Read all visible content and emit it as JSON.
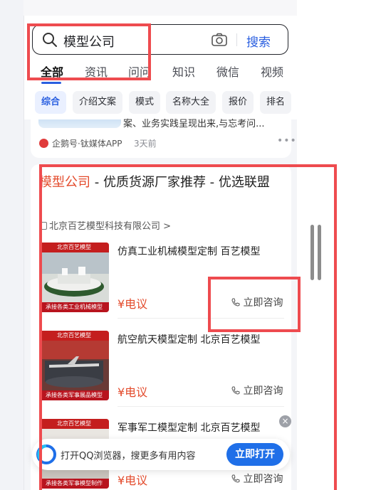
{
  "search": {
    "query": "模型公司",
    "button_label": "搜索"
  },
  "tabs": [
    {
      "label": "全部"
    },
    {
      "label": "资讯"
    },
    {
      "label": "问问"
    },
    {
      "label": "知识"
    },
    {
      "label": "微信"
    },
    {
      "label": "视频"
    }
  ],
  "chips": [
    {
      "label": "综合"
    },
    {
      "label": "介绍文案"
    },
    {
      "label": "模式"
    },
    {
      "label": "名称大全"
    },
    {
      "label": "报价"
    },
    {
      "label": "排名"
    }
  ],
  "prev_card": {
    "snippet": "案、业务实践呈现出来,与忘考问...",
    "source": "企鹅号·钛媒体APP",
    "time": "3天前"
  },
  "ad": {
    "title_highlight": "模型公司",
    "title_rest": " - 优质货源厂家推荐 - 优选联盟",
    "company": "北京百艺模型科技有限公司 >",
    "products": [
      {
        "name": "仿真工业机械模型定制 百艺模型",
        "price": "¥电议",
        "consult": "立即咨询",
        "banner_top": "北京百艺模型",
        "banner_bottom": "承接各类工业机械模型"
      },
      {
        "name": "航空航天模型定制 北京百艺模型",
        "price": "¥电议",
        "consult": "立即咨询",
        "banner_top": "北京百艺模型",
        "banner_bottom": "承接各类军事展品模型"
      },
      {
        "name": "军事军工模型定制 北京百艺模型",
        "price": "¥电议",
        "consult": "立即咨询",
        "banner_top": "北京百艺模型",
        "banner_bottom": "承接各类军事模型制作"
      }
    ]
  },
  "qq_banner": {
    "text": "打开QQ浏览器，搜更多有用内容",
    "button": "立即打开",
    "close": "×"
  },
  "colors": {
    "accent": "#2a5fe0",
    "highlight": "#e34a2b",
    "annotation": "#ee4b4f"
  }
}
